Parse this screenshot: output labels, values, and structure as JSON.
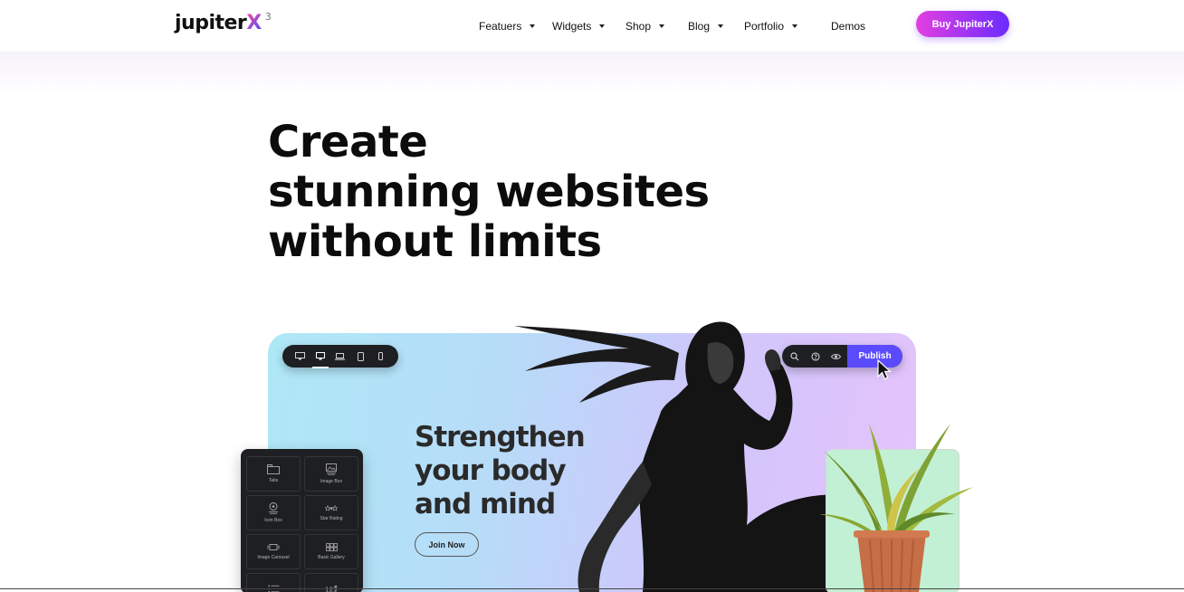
{
  "brand": {
    "name": "jupiter",
    "x": "X",
    "version": "3"
  },
  "nav": [
    {
      "label": "Featuers",
      "has_caret": true
    },
    {
      "label": "Widgets",
      "has_caret": true
    },
    {
      "label": "Shop",
      "has_caret": true
    },
    {
      "label": "Blog",
      "has_caret": true
    },
    {
      "label": "Portfolio",
      "has_caret": true
    },
    {
      "label": "Demos",
      "has_caret": false
    }
  ],
  "cta": {
    "label": "Buy JupiterX"
  },
  "hero": {
    "line1": "Create",
    "line2": "stunning websites",
    "line3": "without limits"
  },
  "preview": {
    "devices": [
      "desktop-wide-icon",
      "desktop-icon",
      "laptop-icon",
      "tablet-icon",
      "mobile-icon"
    ],
    "active_device": "desktop-icon",
    "tools": [
      "search-icon",
      "help-icon",
      "eye-icon"
    ],
    "publish_label": "Publish",
    "headline_line1": "Strengthen",
    "headline_line2": "your body",
    "headline_line3": "and mind",
    "join_label": "Join Now"
  },
  "widgets_panel": {
    "items": [
      {
        "label": "Tabs",
        "icon": "tabs-icon"
      },
      {
        "label": "Image Box",
        "icon": "image-box-icon"
      },
      {
        "label": "Icon Box",
        "icon": "icon-box-icon"
      },
      {
        "label": "Star Rating",
        "icon": "star-rating-icon"
      },
      {
        "label": "Image Carousel",
        "icon": "image-carousel-icon"
      },
      {
        "label": "Basic Gallery",
        "icon": "basic-gallery-icon"
      },
      {
        "label": "",
        "icon": "list-icon"
      },
      {
        "label": "",
        "icon": "counter-icon"
      }
    ]
  },
  "colors": {
    "cta_gradient_start": "#e23fe0",
    "cta_gradient_end": "#6b2bff",
    "publish": "#5b4bff",
    "plant_card": "#c2f0d4"
  }
}
